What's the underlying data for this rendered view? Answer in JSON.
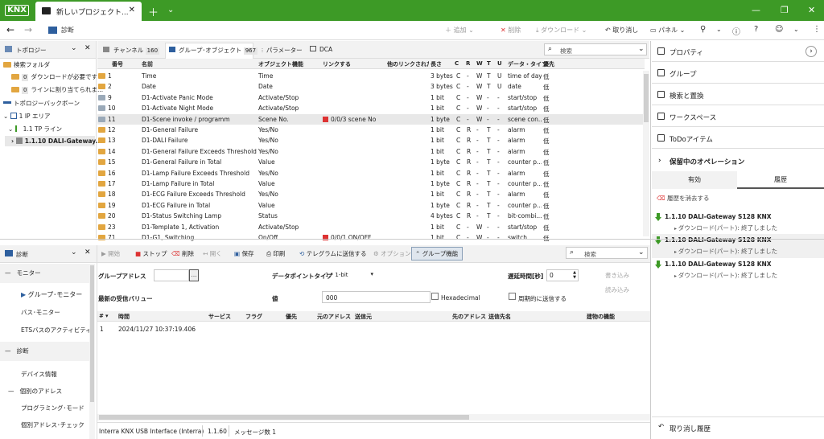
{
  "app": {
    "logo": "KNX",
    "tab_title": "新しいプロジェクト...",
    "window_controls": {
      "min": "—",
      "max": "❐",
      "close": "✕"
    }
  },
  "toolbar": {
    "diagnostics": "診断",
    "add": "追加",
    "delete": "削除",
    "download": "ダウンロード",
    "undo": "取り消し",
    "panel": "パネル"
  },
  "topology": {
    "title": "トポロジー",
    "items": [
      {
        "label": "検索フォルダ",
        "count": ""
      },
      {
        "label": "ダウンロードが必要です",
        "count": "0"
      },
      {
        "label": "ラインに割り当てられま...",
        "count": "0"
      },
      {
        "label": "トポロジーバックボーン",
        "count": ""
      },
      {
        "label": "1 IP エリア",
        "count": ""
      },
      {
        "label": "1.1 TP ライン",
        "count": ""
      },
      {
        "label": "1.1.10 DALI-Gateway...",
        "count": ""
      }
    ]
  },
  "tabs": [
    {
      "label": "チャンネル",
      "count": "160"
    },
    {
      "label": "グループ･オブジェクト",
      "count": "967"
    },
    {
      "label": "パラメーター",
      "count": ""
    },
    {
      "label": "DCA",
      "count": ""
    }
  ],
  "search": {
    "placeholder": "検索"
  },
  "grid": {
    "columns": [
      "番号",
      "名前",
      "オブジェクト機能",
      "リンクする",
      "他のリンクされた",
      "長さ",
      "C",
      "R",
      "W",
      "T",
      "U",
      "データ・タイプ",
      "優先"
    ],
    "rows": [
      [
        "1",
        "Time",
        "Time",
        "",
        "",
        "3 bytes",
        "C",
        "-",
        "W",
        "T",
        "U",
        "time of day",
        "低"
      ],
      [
        "2",
        "Date",
        "Date",
        "",
        "",
        "3 bytes",
        "C",
        "-",
        "W",
        "T",
        "U",
        "date",
        "低"
      ],
      [
        "9",
        "D1-Activate Panic Mode",
        "Activate/Stop",
        "",
        "",
        "1 bit",
        "C",
        "-",
        "W",
        "-",
        "-",
        "start/stop",
        "低"
      ],
      [
        "10",
        "D1-Activate Night Mode",
        "Activate/Stop",
        "",
        "",
        "1 bit",
        "C",
        "-",
        "W",
        "-",
        "-",
        "start/stop",
        "低"
      ],
      [
        "11",
        "D1-Scene invoke / programm",
        "Scene No.",
        "0/0/3 scene No",
        "",
        "1 byte",
        "C",
        "-",
        "W",
        "-",
        "-",
        "scene con...",
        "低"
      ],
      [
        "12",
        "D1-General Failure",
        "Yes/No",
        "",
        "",
        "1 bit",
        "C",
        "R",
        "-",
        "T",
        "-",
        "alarm",
        "低"
      ],
      [
        "13",
        "D1-DALI Failure",
        "Yes/No",
        "",
        "",
        "1 bit",
        "C",
        "R",
        "-",
        "T",
        "-",
        "alarm",
        "低"
      ],
      [
        "14",
        "D1-General Failure Exceeds Threshold",
        "Yes/No",
        "",
        "",
        "1 bit",
        "C",
        "R",
        "-",
        "T",
        "-",
        "alarm",
        "低"
      ],
      [
        "15",
        "D1-General Failure in Total",
        "Value",
        "",
        "",
        "1 byte",
        "C",
        "R",
        "-",
        "T",
        "-",
        "counter p...",
        "低"
      ],
      [
        "16",
        "D1-Lamp Failure Exceeds Threshold",
        "Yes/No",
        "",
        "",
        "1 bit",
        "C",
        "R",
        "-",
        "T",
        "-",
        "alarm",
        "低"
      ],
      [
        "17",
        "D1-Lamp Failure in Total",
        "Value",
        "",
        "",
        "1 byte",
        "C",
        "R",
        "-",
        "T",
        "-",
        "counter p...",
        "低"
      ],
      [
        "18",
        "D1-ECG Failure Exceeds Threshold",
        "Yes/No",
        "",
        "",
        "1 bit",
        "C",
        "R",
        "-",
        "T",
        "-",
        "alarm",
        "低"
      ],
      [
        "19",
        "D1-ECG Failure in Total",
        "Value",
        "",
        "",
        "1 byte",
        "C",
        "R",
        "-",
        "T",
        "-",
        "counter p...",
        "低"
      ],
      [
        "20",
        "D1-Status Switching Lamp",
        "Status",
        "",
        "",
        "4 bytes",
        "C",
        "R",
        "-",
        "T",
        "-",
        "bit-combi...",
        "低"
      ],
      [
        "23",
        "D1-Template 1, Activation",
        "Activate/Stop",
        "",
        "",
        "1 bit",
        "C",
        "-",
        "W",
        "-",
        "-",
        "start/stop",
        "低"
      ],
      [
        "71",
        "D1-G1, Switching",
        "On/Off",
        "0/0/1 ON/OFF",
        "",
        "1 bit",
        "C",
        "-",
        "W",
        "-",
        "-",
        "switch",
        "低"
      ]
    ]
  },
  "right_panel": {
    "items": [
      "プロパティ",
      "グループ",
      "検索と置換",
      "ワークスペース",
      "ToDoアイテム",
      "保留中のオペレーション"
    ],
    "subtabs": [
      "有効",
      "履歴"
    ],
    "clear_history": "履歴を消去する",
    "history": [
      {
        "title": "1.1.10 DALI-Gateway S128 KNX",
        "status": "ダウンロード(パート): 終了しました"
      },
      {
        "title": "1.1.10 DALI-Gateway S128 KNX",
        "status": "ダウンロード(パート): 終了しました"
      },
      {
        "title": "1.1.10 DALI-Gateway S128 KNX",
        "status": "ダウンロード(パート): 終了しました"
      }
    ],
    "undo_history": "取り消し履歴"
  },
  "diag": {
    "title": "診断",
    "monitor_header": "モニター",
    "items": [
      "グループ･モニター",
      "バス･モニター",
      "ETSバスのアクティビティ"
    ],
    "diag_header": "診断",
    "diag_items": [
      "デバイス情報",
      "個別のアドレス",
      "プログラミング･モード",
      "個別アドレス･チェック"
    ]
  },
  "monitor": {
    "toolbar": [
      "開始",
      "ストップ",
      "削除",
      "開く",
      "保存",
      "印刷",
      "テレグラムに送信する",
      "オプション",
      "グループ機能"
    ],
    "group_address_label": "グループアドレス",
    "dpt_label": "データポイントタイプ",
    "dpt_value": "1.* 1-bit",
    "delay_label": "遅延時間[秒]",
    "delay_value": "0",
    "write_btn": "書き込み",
    "read_btn": "読み込み",
    "last_value_label": "最新の受信バリュー",
    "value_label": "値",
    "value_value": "000",
    "hex_label": "Hexadecimal",
    "periodic_label": "周期的に送信する",
    "columns": [
      "#",
      "時間",
      "サービス",
      "フラグ",
      "優先",
      "元のアドレス",
      "送信元",
      "先のアドレス",
      "送信先名",
      "建物の機能"
    ],
    "rows": [
      [
        "1",
        "2024/11/27 10:37:19.406",
        "",
        "",
        "",
        "",
        "",
        "",
        "",
        ""
      ]
    ]
  },
  "status": {
    "interface": "Interra KNX USB Interface (Interra)",
    "address": "1.1.60",
    "messages": "メッセージ数 1"
  }
}
